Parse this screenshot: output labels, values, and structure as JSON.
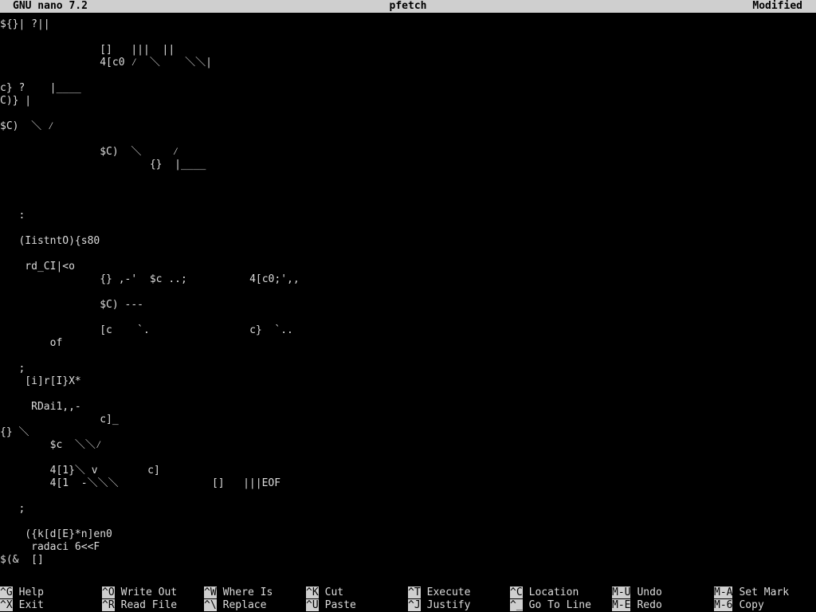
{
  "titlebar": {
    "version": "GNU nano 7.2",
    "filename": "pfetch",
    "status": "Modified"
  },
  "editor_lines": [
    "${}| ?||",
    "",
    "                []   |||  ||",
    "                4[c0 ⁄  ＼    ＼＼|",
    "",
    "c} ?    |____",
    "C)} |",
    "",
    "$C)  ＼ ⁄",
    "",
    "                $C)  ＼     ⁄",
    "                        {}  |____",
    "",
    "",
    "",
    "   :",
    "",
    "   (IistntO){s80",
    "",
    "    rd_CI|<o",
    "                {} ,-'  $c ..;          4[c0;',,",
    "",
    "                $C) ---",
    "",
    "                [c    `.                c}  `..",
    "        of",
    "",
    "   ;",
    "    [i]r[I}X*",
    "",
    "     RDai1,,-",
    "                c]_",
    "{} ＼",
    "        $c  ＼＼⁄",
    "",
    "        4[1}＼ v        c]",
    "        4[1  -＼＼＼               []   |||EOF",
    "",
    "   ;",
    "",
    "    ({k[d[E}*n]en0",
    "     radaci 6<<F",
    "$(&  []"
  ],
  "shortcuts": [
    {
      "key": "^G",
      "label": "Help"
    },
    {
      "key": "^X",
      "label": "Exit"
    },
    {
      "key": "^O",
      "label": "Write Out"
    },
    {
      "key": "^R",
      "label": "Read File"
    },
    {
      "key": "^W",
      "label": "Where Is"
    },
    {
      "key": "^\\",
      "label": "Replace"
    },
    {
      "key": "^K",
      "label": "Cut"
    },
    {
      "key": "^U",
      "label": "Paste"
    },
    {
      "key": "^T",
      "label": "Execute"
    },
    {
      "key": "^J",
      "label": "Justify"
    },
    {
      "key": "^C",
      "label": "Location"
    },
    {
      "key": "^_",
      "label": "Go To Line"
    },
    {
      "key": "M-U",
      "label": "Undo"
    },
    {
      "key": "M-E",
      "label": "Redo"
    },
    {
      "key": "M-A",
      "label": "Set Mark"
    },
    {
      "key": "M-6",
      "label": "Copy"
    }
  ],
  "colors": {
    "background": "#000000",
    "bar": "#cfcfcf",
    "text": "#dcdcdc"
  }
}
